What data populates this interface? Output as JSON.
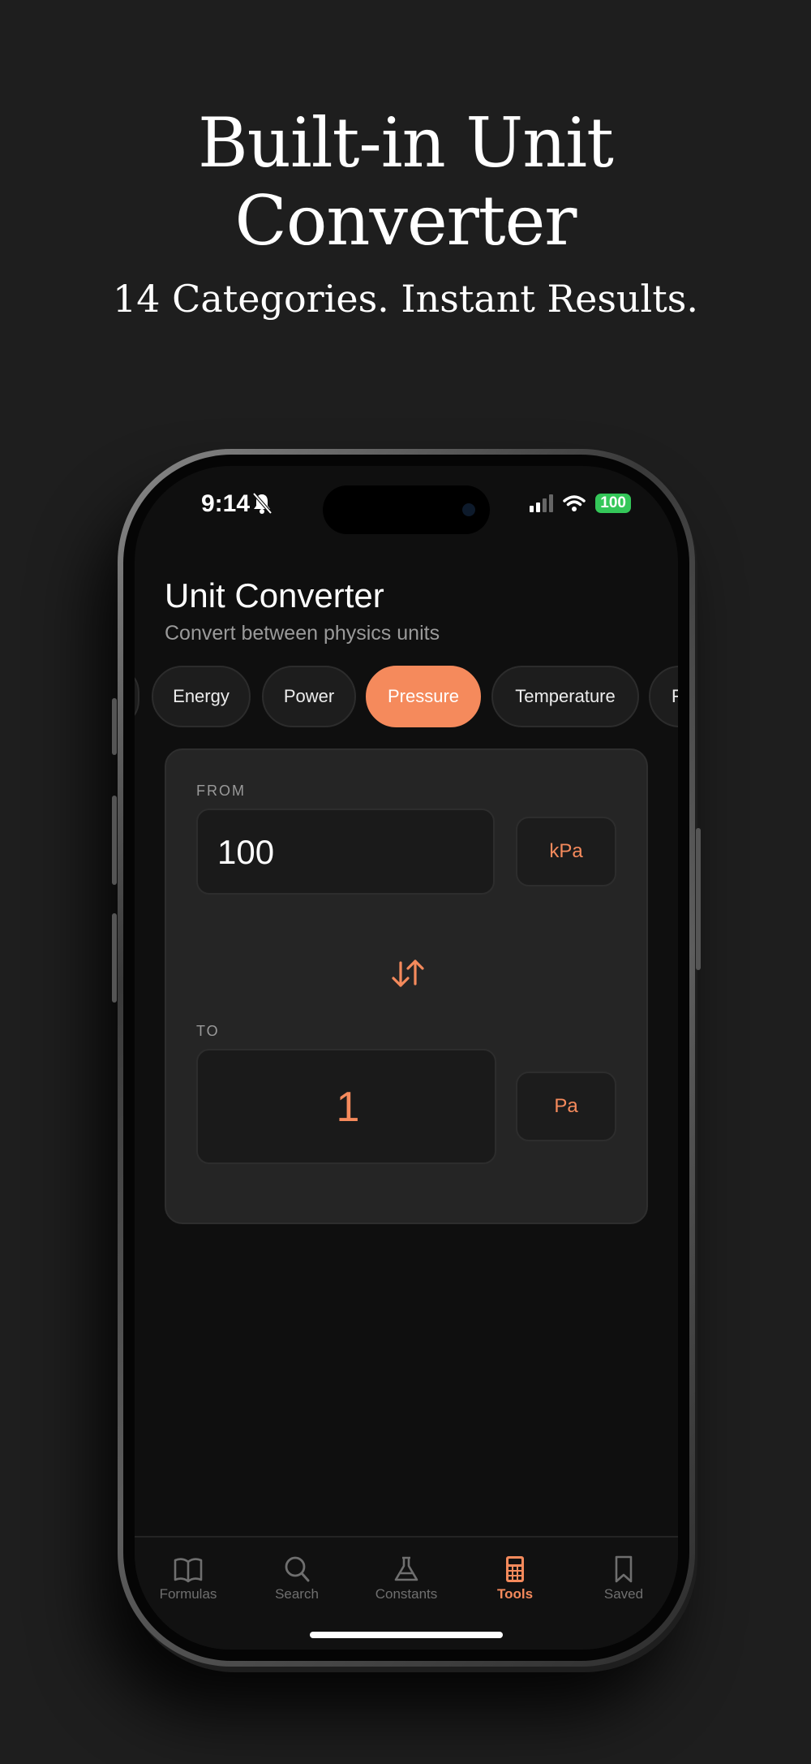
{
  "promo": {
    "headline_line1": "Built-in Unit",
    "headline_line2": "Converter",
    "subheadline": "14 Categories. Instant Results."
  },
  "status_bar": {
    "time": "9:14",
    "battery": "100"
  },
  "app": {
    "title": "Unit Converter",
    "subtitle": "Convert between physics units"
  },
  "categories": [
    {
      "label": "Energy",
      "active": false
    },
    {
      "label": "Power",
      "active": false
    },
    {
      "label": "Pressure",
      "active": true
    },
    {
      "label": "Temperature",
      "active": false
    },
    {
      "label": "F",
      "active": false
    }
  ],
  "converter": {
    "from_label": "FROM",
    "from_value": "100",
    "from_unit": "kPa",
    "to_label": "TO",
    "to_value": "1",
    "to_unit": "Pa"
  },
  "tabbar": {
    "items": [
      {
        "label": "Formulas",
        "icon": "book-icon"
      },
      {
        "label": "Search",
        "icon": "search-icon"
      },
      {
        "label": "Constants",
        "icon": "flask-icon"
      },
      {
        "label": "Tools",
        "icon": "calculator-icon",
        "active": true
      },
      {
        "label": "Saved",
        "icon": "bookmark-icon"
      }
    ]
  },
  "colors": {
    "accent": "#f58a5c",
    "background": "#1e1e1e",
    "screen": "#0f0f0f",
    "card": "#252525",
    "battery": "#34c759"
  }
}
